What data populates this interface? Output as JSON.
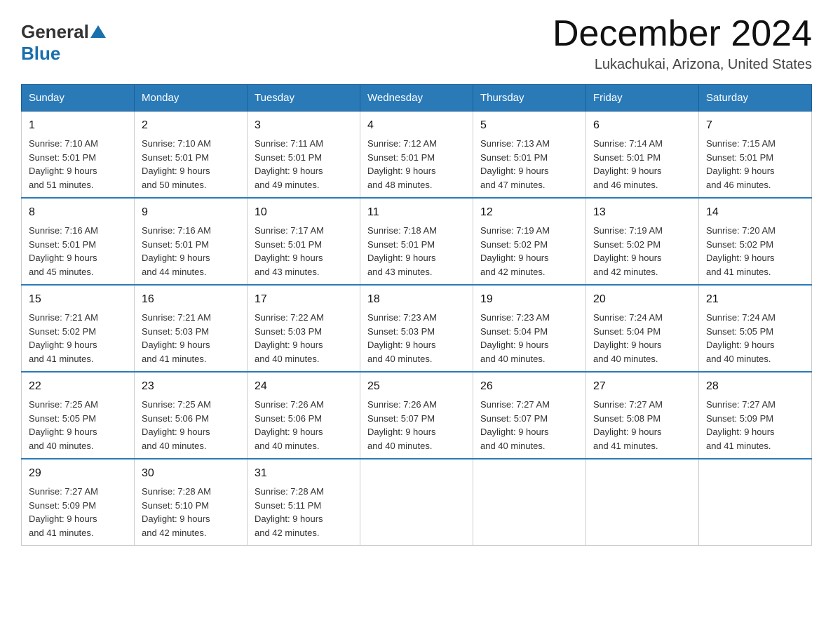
{
  "logo": {
    "general": "General",
    "blue": "Blue"
  },
  "title": "December 2024",
  "subtitle": "Lukachukai, Arizona, United States",
  "days_of_week": [
    "Sunday",
    "Monday",
    "Tuesday",
    "Wednesday",
    "Thursday",
    "Friday",
    "Saturday"
  ],
  "weeks": [
    [
      {
        "day": "1",
        "sunrise": "7:10 AM",
        "sunset": "5:01 PM",
        "daylight": "9 hours and 51 minutes."
      },
      {
        "day": "2",
        "sunrise": "7:10 AM",
        "sunset": "5:01 PM",
        "daylight": "9 hours and 50 minutes."
      },
      {
        "day": "3",
        "sunrise": "7:11 AM",
        "sunset": "5:01 PM",
        "daylight": "9 hours and 49 minutes."
      },
      {
        "day": "4",
        "sunrise": "7:12 AM",
        "sunset": "5:01 PM",
        "daylight": "9 hours and 48 minutes."
      },
      {
        "day": "5",
        "sunrise": "7:13 AM",
        "sunset": "5:01 PM",
        "daylight": "9 hours and 47 minutes."
      },
      {
        "day": "6",
        "sunrise": "7:14 AM",
        "sunset": "5:01 PM",
        "daylight": "9 hours and 46 minutes."
      },
      {
        "day": "7",
        "sunrise": "7:15 AM",
        "sunset": "5:01 PM",
        "daylight": "9 hours and 46 minutes."
      }
    ],
    [
      {
        "day": "8",
        "sunrise": "7:16 AM",
        "sunset": "5:01 PM",
        "daylight": "9 hours and 45 minutes."
      },
      {
        "day": "9",
        "sunrise": "7:16 AM",
        "sunset": "5:01 PM",
        "daylight": "9 hours and 44 minutes."
      },
      {
        "day": "10",
        "sunrise": "7:17 AM",
        "sunset": "5:01 PM",
        "daylight": "9 hours and 43 minutes."
      },
      {
        "day": "11",
        "sunrise": "7:18 AM",
        "sunset": "5:01 PM",
        "daylight": "9 hours and 43 minutes."
      },
      {
        "day": "12",
        "sunrise": "7:19 AM",
        "sunset": "5:02 PM",
        "daylight": "9 hours and 42 minutes."
      },
      {
        "day": "13",
        "sunrise": "7:19 AM",
        "sunset": "5:02 PM",
        "daylight": "9 hours and 42 minutes."
      },
      {
        "day": "14",
        "sunrise": "7:20 AM",
        "sunset": "5:02 PM",
        "daylight": "9 hours and 41 minutes."
      }
    ],
    [
      {
        "day": "15",
        "sunrise": "7:21 AM",
        "sunset": "5:02 PM",
        "daylight": "9 hours and 41 minutes."
      },
      {
        "day": "16",
        "sunrise": "7:21 AM",
        "sunset": "5:03 PM",
        "daylight": "9 hours and 41 minutes."
      },
      {
        "day": "17",
        "sunrise": "7:22 AM",
        "sunset": "5:03 PM",
        "daylight": "9 hours and 40 minutes."
      },
      {
        "day": "18",
        "sunrise": "7:23 AM",
        "sunset": "5:03 PM",
        "daylight": "9 hours and 40 minutes."
      },
      {
        "day": "19",
        "sunrise": "7:23 AM",
        "sunset": "5:04 PM",
        "daylight": "9 hours and 40 minutes."
      },
      {
        "day": "20",
        "sunrise": "7:24 AM",
        "sunset": "5:04 PM",
        "daylight": "9 hours and 40 minutes."
      },
      {
        "day": "21",
        "sunrise": "7:24 AM",
        "sunset": "5:05 PM",
        "daylight": "9 hours and 40 minutes."
      }
    ],
    [
      {
        "day": "22",
        "sunrise": "7:25 AM",
        "sunset": "5:05 PM",
        "daylight": "9 hours and 40 minutes."
      },
      {
        "day": "23",
        "sunrise": "7:25 AM",
        "sunset": "5:06 PM",
        "daylight": "9 hours and 40 minutes."
      },
      {
        "day": "24",
        "sunrise": "7:26 AM",
        "sunset": "5:06 PM",
        "daylight": "9 hours and 40 minutes."
      },
      {
        "day": "25",
        "sunrise": "7:26 AM",
        "sunset": "5:07 PM",
        "daylight": "9 hours and 40 minutes."
      },
      {
        "day": "26",
        "sunrise": "7:27 AM",
        "sunset": "5:07 PM",
        "daylight": "9 hours and 40 minutes."
      },
      {
        "day": "27",
        "sunrise": "7:27 AM",
        "sunset": "5:08 PM",
        "daylight": "9 hours and 41 minutes."
      },
      {
        "day": "28",
        "sunrise": "7:27 AM",
        "sunset": "5:09 PM",
        "daylight": "9 hours and 41 minutes."
      }
    ],
    [
      {
        "day": "29",
        "sunrise": "7:27 AM",
        "sunset": "5:09 PM",
        "daylight": "9 hours and 41 minutes."
      },
      {
        "day": "30",
        "sunrise": "7:28 AM",
        "sunset": "5:10 PM",
        "daylight": "9 hours and 42 minutes."
      },
      {
        "day": "31",
        "sunrise": "7:28 AM",
        "sunset": "5:11 PM",
        "daylight": "9 hours and 42 minutes."
      },
      null,
      null,
      null,
      null
    ]
  ],
  "labels": {
    "sunrise": "Sunrise:",
    "sunset": "Sunset:",
    "daylight": "Daylight:"
  }
}
